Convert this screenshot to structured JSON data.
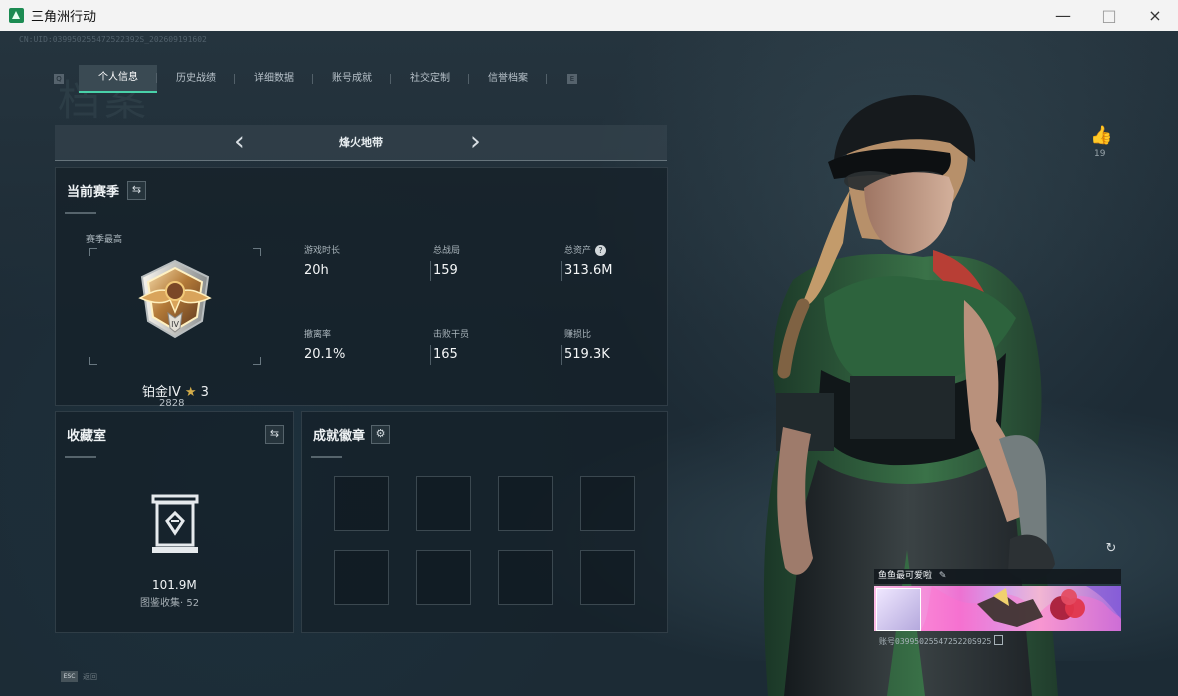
{
  "window": {
    "title": "三角洲行动",
    "controls": {
      "minimize": "—",
      "maximize": "□",
      "close": "×"
    }
  },
  "header": {
    "account_id": "CN:UID:039950255472522392S_202609191602",
    "watermark": "档案"
  },
  "tabs": [
    {
      "label": "个人信息",
      "active": true
    },
    {
      "label": "历史战绩",
      "active": false
    },
    {
      "label": "详细数据",
      "active": false
    },
    {
      "label": "账号成就",
      "active": false
    },
    {
      "label": "社交定制",
      "active": false
    },
    {
      "label": "信誉档案",
      "active": false
    }
  ],
  "tab_controls": {
    "prev": "Q",
    "next": "E"
  },
  "mode": {
    "title": "烽火地带",
    "prev": "‹",
    "next": "›"
  },
  "season": {
    "title": "当前赛季",
    "switch_icon": "⇆",
    "top_label": "赛季最高",
    "rank": {
      "name": "铂金IV",
      "stars": "3",
      "star_icon": "★",
      "score": "2828"
    },
    "stats": [
      {
        "label": "游戏时长",
        "value": "20h"
      },
      {
        "label": "总战局",
        "value": "159"
      },
      {
        "label": "总资产",
        "value": "313.6M",
        "help": "?"
      },
      {
        "label": "撤离率",
        "value": "20.1%"
      },
      {
        "label": "击败干员",
        "value": "165"
      },
      {
        "label": "赚损比",
        "value": "519.3K"
      }
    ]
  },
  "collection": {
    "title": "收藏室",
    "switch_icon": "⇆",
    "value": "101.9M",
    "caption": "图鉴收集· 52"
  },
  "achievement": {
    "title": "成就徽章",
    "settings_icon": "⚙",
    "slots": [
      1,
      2,
      3,
      4,
      5,
      6,
      7,
      8
    ]
  },
  "profile": {
    "likes": "19",
    "like_icon": "👍",
    "refresh_icon": "↻",
    "player_name": "鱼鱼最可爱啦",
    "edit_icon": "✎",
    "uid": "账号0399502554725220S925"
  },
  "footer": {
    "esc_key": "ESC",
    "esc_label": "返回"
  },
  "colors": {
    "accent": "#49d1a9",
    "background": "#20303b",
    "panel": "#152028",
    "rank_gold": "#c99b49"
  },
  "icons": [
    "app-icon",
    "switch-icon",
    "help-icon",
    "settings-icon",
    "vault-icon",
    "like-icon",
    "refresh-icon",
    "edit-icon",
    "copy-icon"
  ]
}
